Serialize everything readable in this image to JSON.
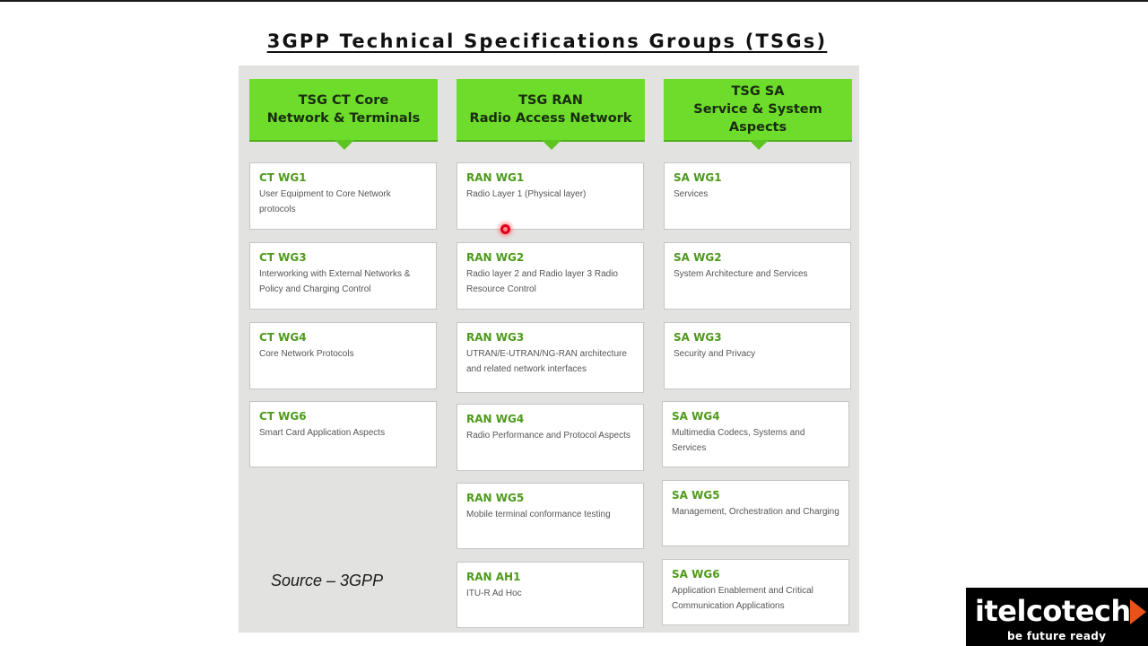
{
  "title": "3GPP Technical Specifications Groups (TSGs)",
  "source": "Source – 3GPP",
  "colors": {
    "header_green": "#6ddc2a",
    "wg_green": "#4e9a1a",
    "panel_gray": "#e2e2e0"
  },
  "columns": [
    {
      "header_line1": "TSG CT Core",
      "header_line2": "Network & Terminals",
      "groups": [
        {
          "name": "CT WG1",
          "desc": "User Equipment to Core Network protocols"
        },
        {
          "name": "CT WG3",
          "desc": "Interworking with External Networks & Policy and Charging Control"
        },
        {
          "name": "CT WG4",
          "desc": "Core Network Protocols"
        },
        {
          "name": "CT WG6",
          "desc": "Smart Card Application Aspects"
        }
      ]
    },
    {
      "header_line1": "TSG RAN",
      "header_line2": "Radio Access Network",
      "groups": [
        {
          "name": "RAN WG1",
          "desc": "Radio Layer 1 (Physical layer)"
        },
        {
          "name": "RAN WG2",
          "desc": "Radio layer 2 and Radio layer 3 Radio Resource Control"
        },
        {
          "name": "RAN WG3",
          "desc": "UTRAN/E-UTRAN/NG-RAN architecture and related network interfaces"
        },
        {
          "name": "RAN WG4",
          "desc": "Radio Performance and Protocol Aspects"
        },
        {
          "name": "RAN WG5",
          "desc": "Mobile terminal conformance testing"
        },
        {
          "name": "RAN AH1",
          "desc": "ITU-R Ad Hoc"
        }
      ]
    },
    {
      "header_line1": "TSG SA",
      "header_line2": "Service & System Aspects",
      "groups": [
        {
          "name": "SA WG1",
          "desc": "Services"
        },
        {
          "name": "SA WG2",
          "desc": "System Architecture and Services"
        },
        {
          "name": "SA WG3",
          "desc": "Security and Privacy"
        },
        {
          "name": "SA WG4",
          "desc": "Multimedia Codecs, Systems and Services"
        },
        {
          "name": "SA WG5",
          "desc": "Management, Orchestration and Charging"
        },
        {
          "name": "SA WG6",
          "desc": "Application Enablement and Critical Communication Applications"
        }
      ]
    }
  ],
  "logo": {
    "brand": "itelcotech",
    "tagline": "be future ready",
    "icon": "play-triangle-icon"
  }
}
